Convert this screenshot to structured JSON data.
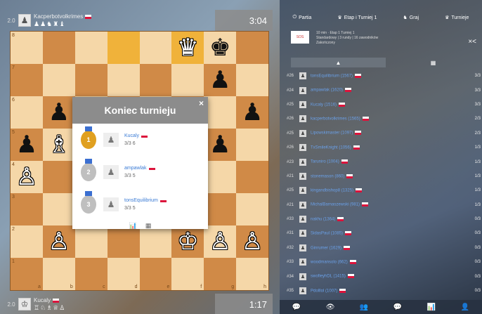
{
  "top_player": {
    "rank": "2.0",
    "name": "Kacperbotvolkrimes",
    "captured": "♟♟♞♜♝",
    "clock": "3:04"
  },
  "bottom_player": {
    "rank": "2.0",
    "name": "Kucaly",
    "captured": "♖♘♗♕♙",
    "clock": "1:17"
  },
  "board": {
    "ranks": [
      "8",
      "7",
      "6",
      "5",
      "4",
      "3",
      "2",
      "1"
    ],
    "files": [
      "a",
      "b",
      "c",
      "d",
      "e",
      "f",
      "g",
      "h"
    ],
    "highlight": [
      "d8",
      "f8"
    ],
    "pieces": {
      "f8": "♛",
      "g8": "♚",
      "g7": "♟",
      "b6": "♟",
      "h6": "♟",
      "a5": "♟",
      "b5": "♗",
      "g5": "♟",
      "a4": "♙",
      "b2": "♙",
      "f2": "♔",
      "g2": "♙",
      "h2": "♙"
    },
    "white_pieces": [
      "f8",
      "b5",
      "a4",
      "b2",
      "f2",
      "g2",
      "h2"
    ]
  },
  "modal": {
    "title": "Koniec turnieju",
    "close": "×",
    "players": [
      {
        "place": "1",
        "name": "Kucaly",
        "score": "3/3",
        "tb": "6",
        "medal": "gold"
      },
      {
        "place": "2",
        "name": "ampawlak",
        "score": "3/3",
        "tb": "5",
        "medal": "silver"
      },
      {
        "place": "3",
        "name": "tonsEquilibrium",
        "score": "3/3",
        "tb": "5",
        "medal": "silver"
      }
    ],
    "footer_icons": [
      "chart-icon",
      "grid-icon"
    ]
  },
  "sidebar": {
    "tabs": [
      {
        "icon": "⏻",
        "label": "Partia"
      },
      {
        "icon": "♛",
        "label": "Etap i Turniej 1"
      },
      {
        "icon": "♞",
        "label": "Graj"
      },
      {
        "icon": "♛",
        "label": "Turnieje"
      }
    ],
    "tournament": {
      "logo": "SOS",
      "line1": "10 min · Etap 1 Turniej 1",
      "line2": "Standardowy | 3 rundy | 16 zawodników",
      "line3": "Zakończony",
      "share": "×<"
    },
    "subtabs": [
      "▲",
      "▦"
    ],
    "standings": [
      {
        "rank": "#26",
        "name": "tonsEquilibrium",
        "rating": "(1567)",
        "score": "3/3"
      },
      {
        "rank": "#24",
        "name": "ampawlak",
        "rating": "(1620)",
        "score": "3/3"
      },
      {
        "rank": "#25",
        "name": "Kucaly",
        "rating": "(1516)",
        "score": "3/3"
      },
      {
        "rank": "#26",
        "name": "kacperbotvolkrimes",
        "rating": "(1565)",
        "score": "2/3"
      },
      {
        "rank": "#25",
        "name": "Lipowskimaster",
        "rating": "(1097)",
        "score": "2/3"
      },
      {
        "rank": "#26",
        "name": "TxSmileKnight",
        "rating": "(1056)",
        "score": "1/3"
      },
      {
        "rank": "#23",
        "name": "Taruniro",
        "rating": "(1004)",
        "score": "1/3"
      },
      {
        "rank": "#21",
        "name": "stonemason",
        "rating": "(860)",
        "score": "1/3"
      },
      {
        "rank": "#25",
        "name": "kingandbishop8",
        "rating": "(1325)",
        "score": "1/3"
      },
      {
        "rank": "#21",
        "name": "MichalBarnaszewski",
        "rating": "(981)",
        "score": "1/3"
      },
      {
        "rank": "#33",
        "name": "nakhu",
        "rating": "(1364)",
        "score": "0/3"
      },
      {
        "rank": "#31",
        "name": "SidasPaul",
        "rating": "(1085)",
        "score": "0/3"
      },
      {
        "rank": "#32",
        "name": "Ginrumer",
        "rating": "(1629)",
        "score": "0/3"
      },
      {
        "rank": "#33",
        "name": "woodmansolo",
        "rating": "(662)",
        "score": "0/3"
      },
      {
        "rank": "#34",
        "name": "swofieyhDL",
        "rating": "(1415)",
        "score": "0/3"
      },
      {
        "rank": "#35",
        "name": "Pdolllol",
        "rating": "(1007)",
        "score": "0/3"
      }
    ],
    "bottom_nav": [
      "💬",
      "👁",
      "👥",
      "💬",
      "📊",
      "👤"
    ]
  }
}
